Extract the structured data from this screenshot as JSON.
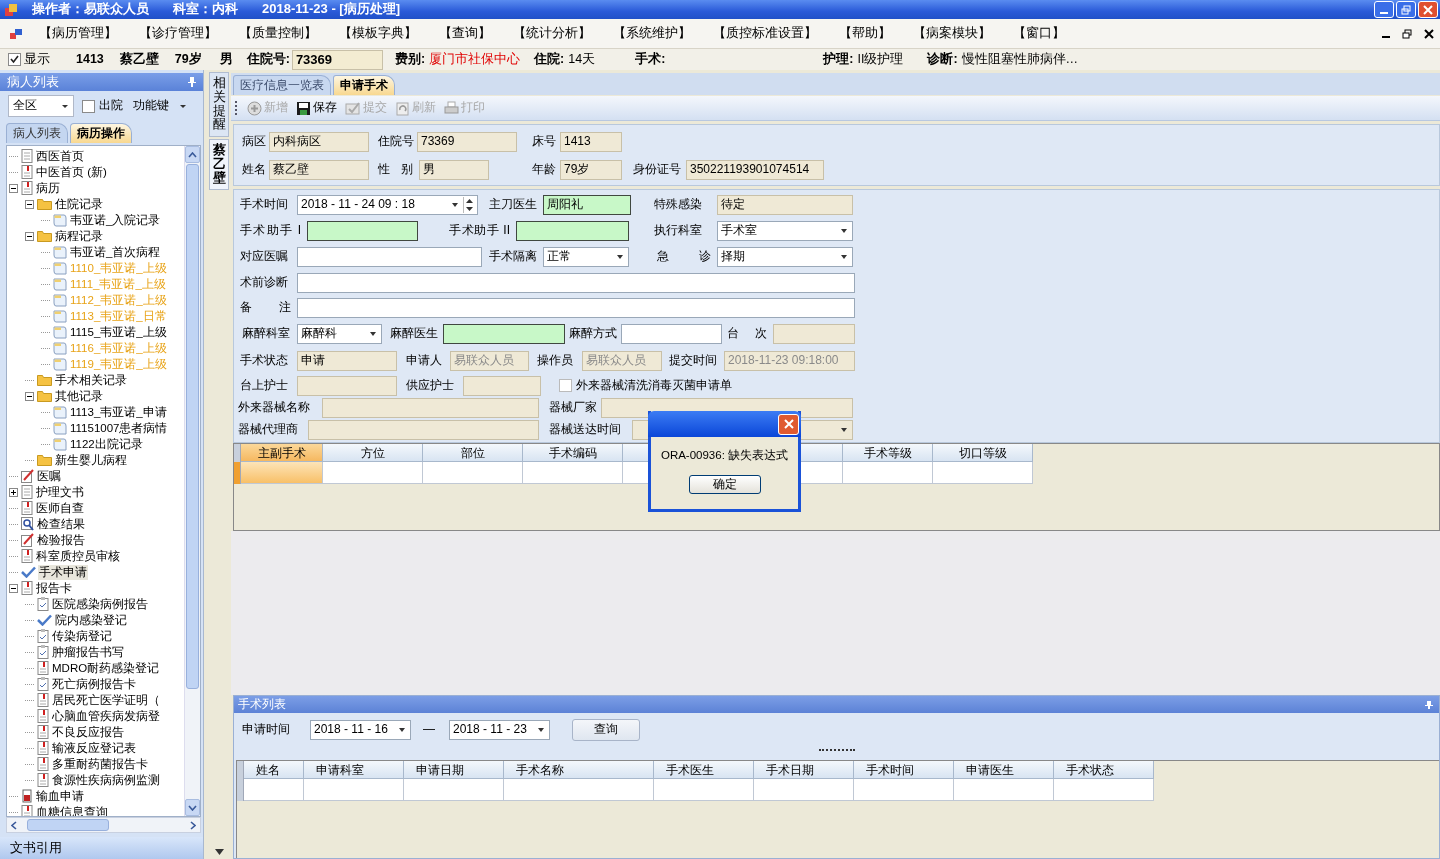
{
  "title_bar": {
    "texts": [
      "操作者：易联众人员",
      "科室：内科",
      "2018-11-23 - [病历处理]"
    ]
  },
  "menu": [
    "【病历管理】",
    "【诊疗管理】",
    "【质量控制】",
    "【模板字典】",
    "【查询】",
    "【统计分析】",
    "【系统维护】",
    "【质控标准设置】",
    "【帮助】",
    "【病案模块】",
    "【窗口】"
  ],
  "patient_bar": {
    "show": {
      "label": "显示",
      "checked": true
    },
    "items": [
      {
        "kind": "plain",
        "text": "1413"
      },
      {
        "kind": "plain",
        "text": "蔡乙壁"
      },
      {
        "kind": "plain",
        "text": "79岁"
      },
      {
        "kind": "plain",
        "text": "男"
      },
      {
        "kind": "field",
        "label": "住院号:",
        "value": "73369"
      },
      {
        "kind": "alert",
        "label": "费别:",
        "value": "厦门市社保中心"
      },
      {
        "kind": "pair",
        "label": "住院:",
        "value": "14天"
      },
      {
        "kind": "pair",
        "label": "手术:"
      },
      {
        "kind": "pair",
        "label": "护理:",
        "value": "II级护理"
      },
      {
        "kind": "pair",
        "label": "诊断:",
        "value": "慢性阻塞性肺病伴…"
      }
    ]
  },
  "left_panel": {
    "title": "病人列表",
    "ward": "全区",
    "discharged": {
      "label": "出院",
      "checked": false
    },
    "function_key": "功能键",
    "tabs": [
      {
        "label": "病人列表",
        "selected": false
      },
      {
        "label": "病历操作",
        "selected": true
      }
    ],
    "tree": [
      {
        "label": "西医首页",
        "kind": "page",
        "selected": false
      },
      {
        "label": "中医首页 (新)",
        "kind": "form",
        "selected": false
      },
      {
        "label": "病历",
        "kind": "form",
        "selected": false,
        "expanded": true,
        "children": [
          {
            "label": "住院记录",
            "kind": "folder",
            "selected": false,
            "expanded": true,
            "children": [
              {
                "label": "韦亚诺_入院记录",
                "kind": "record",
                "selected": false
              }
            ]
          },
          {
            "label": "病程记录",
            "kind": "folder",
            "selected": false,
            "expanded": true,
            "children": [
              {
                "label": "韦亚诺_首次病程",
                "kind": "record",
                "selected": false,
                "highlighted": false
              },
              {
                "label": "1110_韦亚诺_上级",
                "kind": "record",
                "selected": false,
                "highlighted": true
              },
              {
                "label": "1111_韦亚诺_上级",
                "kind": "record",
                "selected": false,
                "highlighted": true
              },
              {
                "label": "1112_韦亚诺_上级",
                "kind": "record",
                "selected": false,
                "highlighted": true
              },
              {
                "label": "1113_韦亚诺_日常",
                "kind": "record",
                "selected": false,
                "highlighted": true
              },
              {
                "label": "1115_韦亚诺_上级",
                "kind": "record",
                "selected": false,
                "highlighted": false
              },
              {
                "label": "1116_韦亚诺_上级",
                "kind": "record",
                "selected": false,
                "highlighted": true
              },
              {
                "label": "1119_韦亚诺_上级",
                "kind": "record",
                "selected": false,
                "highlighted": true
              }
            ]
          },
          {
            "label": "手术相关记录",
            "kind": "folder",
            "selected": false
          },
          {
            "label": "其他记录",
            "kind": "folder",
            "selected": false,
            "expanded": true,
            "children": [
              {
                "label": "1113_韦亚诺_申请",
                "kind": "record",
                "selected": false
              },
              {
                "label": "11151007患者病情",
                "kind": "record",
                "selected": false
              },
              {
                "label": "1122出院记录",
                "kind": "record",
                "selected": false
              }
            ]
          },
          {
            "label": "新生婴儿病程",
            "kind": "folder",
            "selected": false
          }
        ]
      },
      {
        "label": "医嘱",
        "kind": "pen",
        "selected": false
      },
      {
        "label": "护理文书",
        "kind": "page",
        "selected": false,
        "expanded": false
      },
      {
        "label": "医师自查",
        "kind": "form",
        "selected": false
      },
      {
        "label": "检查结果",
        "kind": "lens",
        "selected": false
      },
      {
        "label": "检验报告",
        "kind": "pen",
        "selected": false
      },
      {
        "label": "科室质控员审核",
        "kind": "form",
        "selected": false
      },
      {
        "label": "手术申请",
        "kind": "tick",
        "selected": true
      },
      {
        "label": "报告卡",
        "kind": "form",
        "selected": false,
        "expanded": true,
        "children": [
          {
            "label": "医院感染病例报告",
            "kind": "clip",
            "selected": false
          },
          {
            "label": "院内感染登记",
            "kind": "tick",
            "selected": false
          },
          {
            "label": "传染病登记",
            "kind": "clip",
            "selected": false
          },
          {
            "label": "肿瘤报告书写",
            "kind": "clip",
            "selected": false
          },
          {
            "label": "MDRO耐药感染登记",
            "kind": "form",
            "selected": false
          },
          {
            "label": "死亡病例报告卡",
            "kind": "clip",
            "selected": false
          },
          {
            "label": "居民死亡医学证明（",
            "kind": "form",
            "selected": false
          },
          {
            "label": "心脑血管疾病发病登",
            "kind": "form",
            "selected": false
          },
          {
            "label": "不良反应报告",
            "kind": "form",
            "selected": false
          },
          {
            "label": "输液反应登记表",
            "kind": "form",
            "selected": false
          },
          {
            "label": "多重耐药菌报告卡",
            "kind": "form",
            "selected": false
          },
          {
            "label": "食源性疾病病例监测",
            "kind": "form",
            "selected": false
          }
        ]
      },
      {
        "label": "输血申请",
        "kind": "blood",
        "selected": false
      },
      {
        "label": "血糖信息查询",
        "kind": "form",
        "selected": false
      }
    ],
    "footer": "文书引用"
  },
  "side_tabs": [
    {
      "label": "相关提醒",
      "selected": false
    },
    {
      "label": "蔡乙壁",
      "selected": true
    }
  ],
  "main_tabs": [
    {
      "label": "医疗信息一览表",
      "selected": false
    },
    {
      "label": "申请手术",
      "selected": true
    }
  ],
  "toolbar": [
    {
      "kind": "add",
      "label": "新增",
      "disabled": true
    },
    {
      "kind": "save",
      "label": "保存",
      "disabled": false
    },
    {
      "kind": "submit",
      "label": "提交",
      "disabled": true
    },
    {
      "kind": "refresh",
      "label": "刷新",
      "disabled": true
    },
    {
      "kind": "print",
      "label": "打印",
      "disabled": true
    }
  ],
  "basic_rows": [
    [
      {
        "label": "病区",
        "value": "内科病区",
        "readonly": true
      },
      {
        "label": "住院号",
        "value": "73369",
        "readonly": true
      },
      {
        "label": "床号",
        "value": "1413",
        "readonly": true
      }
    ],
    [
      {
        "label": "姓名",
        "value": "蔡乙壁",
        "readonly": true
      },
      {
        "label": "性 别",
        "value": "男",
        "readonly": true
      },
      {
        "label": "年龄",
        "value": "79岁",
        "readonly": true
      },
      {
        "label": "身份证号",
        "value": "350221193901074514",
        "readonly": true
      }
    ]
  ],
  "form_rows": [
    [
      {
        "label": "手术时间",
        "value": "2018 - 11 - 24    09 : 18",
        "kind": "datetime",
        "readonly": false,
        "required": false
      },
      {
        "label": "主刀医生",
        "value": "周阳礼",
        "kind": "text",
        "readonly": false,
        "required": true
      },
      {
        "label": "特殊感染",
        "value": "待定",
        "kind": "text",
        "readonly": true,
        "required": false
      }
    ],
    [
      {
        "label": "手术助手 I",
        "kind": "text",
        "readonly": false,
        "required": true
      },
      {
        "label": "手术助手 II",
        "kind": "text",
        "readonly": false,
        "required": true
      },
      {
        "label": "执行科室",
        "value": "手术室",
        "kind": "combo",
        "readonly": false,
        "required": false
      }
    ],
    [
      {
        "label": "对应医嘱",
        "kind": "text",
        "readonly": false,
        "required": false
      },
      {
        "label": "手术隔离",
        "value": "正常",
        "kind": "combo",
        "readonly": false,
        "required": false
      },
      {
        "label": "急 诊",
        "value": "择期",
        "kind": "combo",
        "readonly": false,
        "required": false
      }
    ],
    [
      {
        "label": "术前诊断",
        "kind": "text",
        "readonly": false,
        "required": false
      }
    ],
    [
      {
        "label": "备 注",
        "kind": "text",
        "readonly": false,
        "required": false
      }
    ],
    [
      {
        "label": "麻醉科室",
        "value": "麻醉科",
        "kind": "combo",
        "readonly": false,
        "required": false
      },
      {
        "label": "麻醉医生",
        "kind": "text",
        "readonly": false,
        "required": true
      },
      {
        "label": "麻醉方式",
        "kind": "text",
        "readonly": false,
        "required": false
      },
      {
        "label": "台 次",
        "kind": "text",
        "readonly": true,
        "required": false
      }
    ],
    [
      {
        "label": "手术状态",
        "value": "申请",
        "kind": "text",
        "readonly": true,
        "required": false,
        "disabled": false
      },
      {
        "label": "申请人",
        "value": "易联众人员",
        "kind": "text",
        "readonly": true,
        "required": false,
        "disabled": true
      },
      {
        "label": "操作员",
        "value": "易联众人员",
        "kind": "text",
        "readonly": true,
        "required": false,
        "disabled": true
      },
      {
        "label": "提交时间",
        "value": "2018-11-23 09:18:00",
        "kind": "text",
        "readonly": true,
        "required": false,
        "disabled": true
      }
    ],
    [
      {
        "label": "台上护士",
        "kind": "text",
        "readonly": true,
        "required": false
      },
      {
        "label": "供应护士",
        "kind": "text",
        "readonly": true,
        "required": false
      },
      {
        "label": "外来器械清洗消毒灭菌申请单",
        "kind": "check",
        "checked": false
      }
    ],
    [
      {
        "label": "外来器械名称",
        "kind": "text",
        "readonly": true,
        "required": false
      },
      {
        "label": "器械厂家",
        "kind": "text",
        "readonly": true,
        "required": false
      }
    ],
    [
      {
        "label": "器械代理商",
        "kind": "text",
        "readonly": true,
        "required": false
      },
      {
        "label": "器械送达时间",
        "kind": "combo",
        "readonly": true,
        "required": false
      }
    ]
  ],
  "grid": {
    "columns": [
      "主副手术",
      "方位",
      "部位",
      "手术编码",
      "手术等级",
      "切口等级"
    ]
  },
  "dialog": {
    "message": "ORA-00936: 缺失表达式",
    "button": "确定"
  },
  "list_panel": {
    "title": "手术列表",
    "date_label": "申请时间",
    "from": "2018 - 11 - 16",
    "separator": "—",
    "to": "2018 - 11 - 23",
    "query": "查询",
    "columns": [
      "姓名",
      "申请科室",
      "申请日期",
      "手术名称",
      "手术医生",
      "手术日期",
      "手术时间",
      "申请医生",
      "手术状态"
    ]
  }
}
